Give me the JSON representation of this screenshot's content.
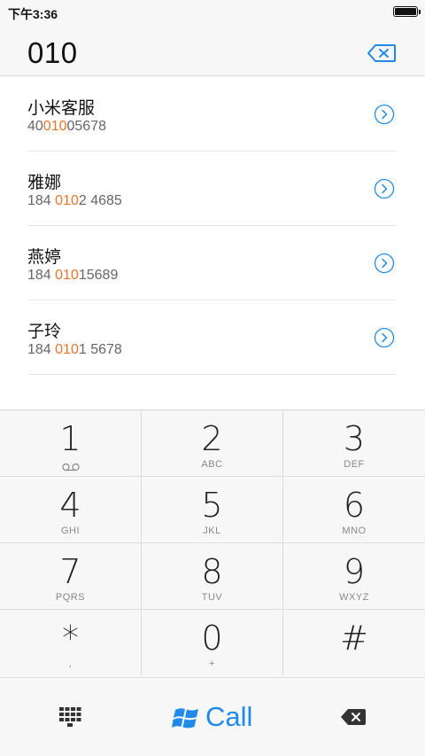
{
  "status_bar": {
    "time": "下午3:36"
  },
  "dialer": {
    "number": "010"
  },
  "contacts": [
    {
      "name": "小米客服",
      "number_parts": [
        "40",
        "010",
        "05678"
      ]
    },
    {
      "name": "雅娜",
      "number_parts": [
        "184 ",
        "010",
        "2 4685"
      ]
    },
    {
      "name": "燕婷",
      "number_parts": [
        "184 ",
        "010",
        "15689"
      ]
    },
    {
      "name": "子玲",
      "number_parts": [
        "184 ",
        "010",
        "1 5678"
      ]
    }
  ],
  "keypad": {
    "keys": [
      {
        "digit": "1",
        "letters": ""
      },
      {
        "digit": "2",
        "letters": "ABC"
      },
      {
        "digit": "3",
        "letters": "DEF"
      },
      {
        "digit": "4",
        "letters": "GHI"
      },
      {
        "digit": "5",
        "letters": "JKL"
      },
      {
        "digit": "6",
        "letters": "MNO"
      },
      {
        "digit": "7",
        "letters": "PQRS"
      },
      {
        "digit": "8",
        "letters": "TUV"
      },
      {
        "digit": "9",
        "letters": "WXYZ"
      },
      {
        "digit": "*",
        "letters": ","
      },
      {
        "digit": "0",
        "letters": "+"
      },
      {
        "digit": "#",
        "letters": ""
      }
    ]
  },
  "bottom_bar": {
    "call_label": "Call"
  },
  "colors": {
    "accent_blue": "#1f8ae8",
    "highlight_orange": "#e8762d"
  },
  "icons": {
    "voicemail": "voicemail-icon",
    "detail": "chevron-circle-right-icon",
    "backspace": "backspace-icon",
    "grid": "keypad-grid-icon",
    "windows": "windows-logo-icon",
    "battery": "battery-icon"
  }
}
